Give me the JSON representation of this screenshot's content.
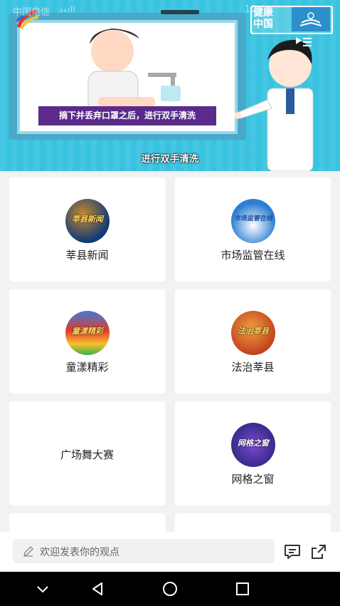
{
  "status_bar": {
    "carrier": "中国电信",
    "signal": "₄₆ıll",
    "time": "10"
  },
  "video": {
    "caption_box": "摘下并丢弃口罩之后，进行双手清洗",
    "subtitle": "进行双手清洗",
    "brand": "健康\n中国"
  },
  "cards": [
    {
      "label": "莘县新闻",
      "thumb_text": "莘县新闻",
      "colors": [
        "#0f3a78",
        "#c88a2a"
      ]
    },
    {
      "label": "市场监管在线",
      "thumb_text": "市场监管在线",
      "colors": [
        "#2a7fd1",
        "#ffffff"
      ]
    },
    {
      "label": "童漾精彩",
      "thumb_text": "童漾精彩",
      "colors": [
        "#e23c2c",
        "#3b7bd6"
      ]
    },
    {
      "label": "法治莘县",
      "thumb_text": "法治莘县",
      "colors": [
        "#c2431e",
        "#f0a040"
      ]
    },
    {
      "label": "广场舞大赛"
    },
    {
      "label": "网格之窗",
      "thumb_text": "网格之窗",
      "colors": [
        "#3a2a8a",
        "#7a4ad0"
      ]
    }
  ],
  "comment": {
    "placeholder": "欢迎发表你的观点"
  },
  "icons": {
    "comment": "comment-icon",
    "share": "share-icon",
    "edit": "pencil-icon",
    "back": "back-triangle-icon",
    "home": "home-circle-icon",
    "recent": "recent-square-icon",
    "collapse": "chevron-down-icon"
  }
}
